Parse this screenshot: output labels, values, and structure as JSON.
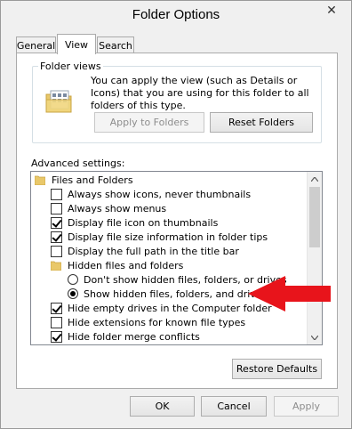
{
  "window": {
    "title": "Folder Options",
    "close_glyph": "✕"
  },
  "tabs": [
    {
      "label": "General",
      "active": false
    },
    {
      "label": "View",
      "active": true
    },
    {
      "label": "Search",
      "active": false
    }
  ],
  "folder_views": {
    "group_label": "Folder views",
    "description": "You can apply the view (such as Details or Icons) that you are using for this folder to all folders of this type.",
    "apply_label": "Apply to Folders",
    "reset_label": "Reset Folders"
  },
  "advanced": {
    "label": "Advanced settings:",
    "items": [
      {
        "type": "folder",
        "label": "Files and Folders"
      },
      {
        "type": "checkbox",
        "label": "Always show icons, never thumbnails",
        "checked": false
      },
      {
        "type": "checkbox",
        "label": "Always show menus",
        "checked": false
      },
      {
        "type": "checkbox",
        "label": "Display file icon on thumbnails",
        "checked": true
      },
      {
        "type": "checkbox",
        "label": "Display file size information in folder tips",
        "checked": true
      },
      {
        "type": "checkbox",
        "label": "Display the full path in the title bar",
        "checked": false
      },
      {
        "type": "folder",
        "label": "Hidden files and folders"
      },
      {
        "type": "radio",
        "label": "Don't show hidden files, folders, or drives",
        "checked": false
      },
      {
        "type": "radio",
        "label": "Show hidden files, folders, and drives",
        "checked": true
      },
      {
        "type": "checkbox",
        "label": "Hide empty drives in the Computer folder",
        "checked": true
      },
      {
        "type": "checkbox",
        "label": "Hide extensions for known file types",
        "checked": false
      },
      {
        "type": "checkbox",
        "label": "Hide folder merge conflicts",
        "checked": true
      }
    ]
  },
  "buttons": {
    "restore_defaults": "Restore Defaults",
    "ok": "OK",
    "cancel": "Cancel",
    "apply": "Apply"
  },
  "colors": {
    "annotation_arrow": "#e8141b"
  }
}
